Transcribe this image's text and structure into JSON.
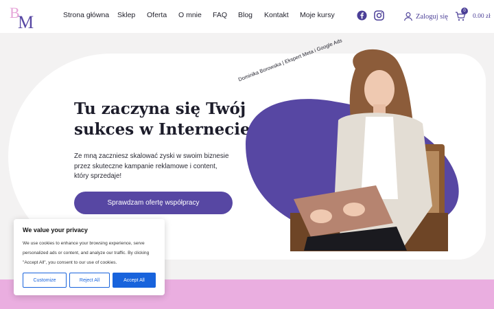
{
  "brand": {
    "logo_letters": [
      "B",
      "M"
    ]
  },
  "nav": {
    "items": [
      "Strona główna",
      "Sklep",
      "Oferta",
      "O mnie",
      "FAQ",
      "Blog",
      "Kontakt",
      "Moje kursy"
    ]
  },
  "social": {
    "icons": [
      "facebook-icon",
      "instagram-icon"
    ]
  },
  "account": {
    "login_label": "Zaloguj się"
  },
  "cart": {
    "count": "0",
    "total": "0.00 zł"
  },
  "hero": {
    "headline": "Tu zaczyna się Twój sukces w Internecie",
    "description": "Ze mną zaczniesz skalować zyski w swoim biznesie przez skuteczne kampanie reklamowe i content, który sprzedaje!",
    "cta_label": "Sprawdzam ofertę współpracy",
    "tagline": "Dominika Borowska | Ekspert Meta i Google Ads"
  },
  "cookie": {
    "title": "We value your privacy",
    "text": "We use cookies to enhance your browsing experience, serve personalized ads or content, and analyze our traffic. By clicking \"Accept All\", you consent to our use of cookies.",
    "customize_label": "Customize",
    "reject_label": "Reject All",
    "accept_label": "Accept All"
  },
  "colors": {
    "accent": "#5747a3",
    "pink": "#eaaee0",
    "background": "#f3f2f2",
    "cookie_blue": "#1863dc"
  }
}
